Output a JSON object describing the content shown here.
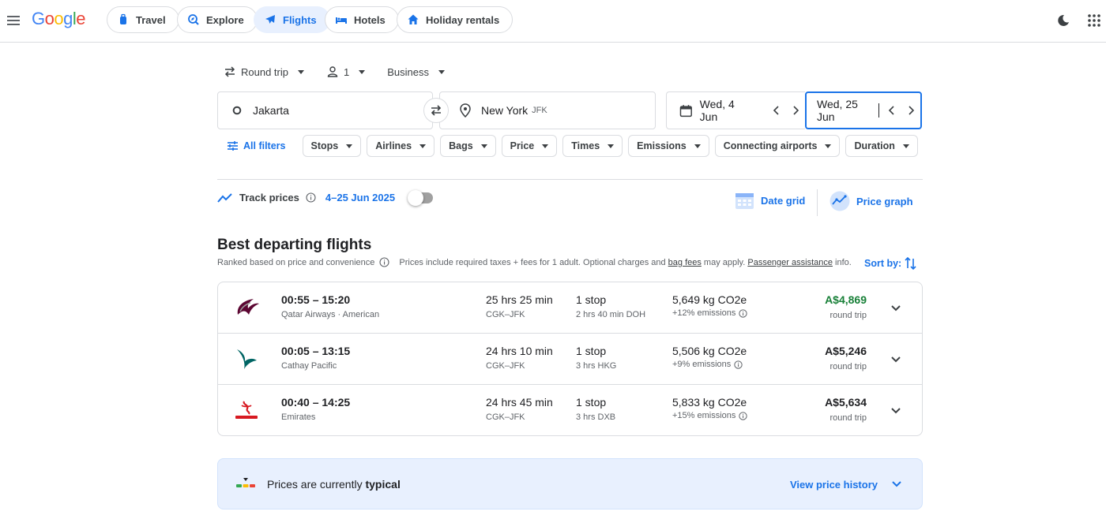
{
  "header": {
    "logo": "Google",
    "nav": [
      {
        "label": "Travel",
        "icon": "luggage-icon",
        "active": false
      },
      {
        "label": "Explore",
        "icon": "explore-icon",
        "active": false
      },
      {
        "label": "Flights",
        "icon": "plane-icon",
        "active": true
      },
      {
        "label": "Hotels",
        "icon": "bed-icon",
        "active": false
      },
      {
        "label": "Holiday rentals",
        "icon": "house-icon",
        "active": false
      }
    ]
  },
  "search": {
    "trip_type": "Round trip",
    "passengers": "1",
    "cabin": "Business",
    "origin": "Jakarta",
    "destination": "New York",
    "destination_code": "JFK",
    "depart_date": "Wed, 4 Jun",
    "return_date": "Wed, 25 Jun"
  },
  "filters": {
    "all_filters": "All filters",
    "chips": [
      "Stops",
      "Airlines",
      "Bags",
      "Price",
      "Times",
      "Emissions",
      "Connecting airports",
      "Duration"
    ]
  },
  "tracking": {
    "label": "Track prices",
    "range": "4–25 Jun 2025",
    "enabled": false
  },
  "views": {
    "date_grid": "Date grid",
    "price_graph": "Price graph"
  },
  "results": {
    "title": "Best departing flights",
    "ranked_note": "Ranked based on price and convenience",
    "price_note_1": "Prices include required taxes + fees for 1 adult. Optional charges and ",
    "bag_fees": "bag fees",
    "price_note_2": " may apply. ",
    "passenger_assistance": "Passenger assistance",
    "price_note_3": " info.",
    "sort_by": "Sort by:",
    "flights": [
      {
        "times": "00:55 – 15:20",
        "airline": "Qatar Airways · American",
        "duration": "25 hrs 25 min",
        "route": "CGK–JFK",
        "stops": "1 stop",
        "layover": "2 hrs 40 min DOH",
        "co2": "5,649 kg CO2e",
        "emissions": "+12% emissions",
        "price": "A$4,869",
        "price_color": "#188038",
        "price_type": "round trip"
      },
      {
        "times": "00:05 – 13:15",
        "airline": "Cathay Pacific",
        "duration": "24 hrs 10 min",
        "route": "CGK–JFK",
        "stops": "1 stop",
        "layover": "3 hrs HKG",
        "co2": "5,506 kg CO2e",
        "emissions": "+9% emissions",
        "price": "A$5,246",
        "price_color": "#202124",
        "price_type": "round trip"
      },
      {
        "times": "00:40 – 14:25",
        "airline": "Emirates",
        "duration": "24 hrs 45 min",
        "route": "CGK–JFK",
        "stops": "1 stop",
        "layover": "3 hrs DXB",
        "co2": "5,833 kg CO2e",
        "emissions": "+15% emissions",
        "price": "A$5,634",
        "price_color": "#202124",
        "price_type": "round trip"
      }
    ]
  },
  "price_insight": {
    "text_prefix": "Prices are currently ",
    "text_bold": "typical",
    "link": "View price history"
  }
}
